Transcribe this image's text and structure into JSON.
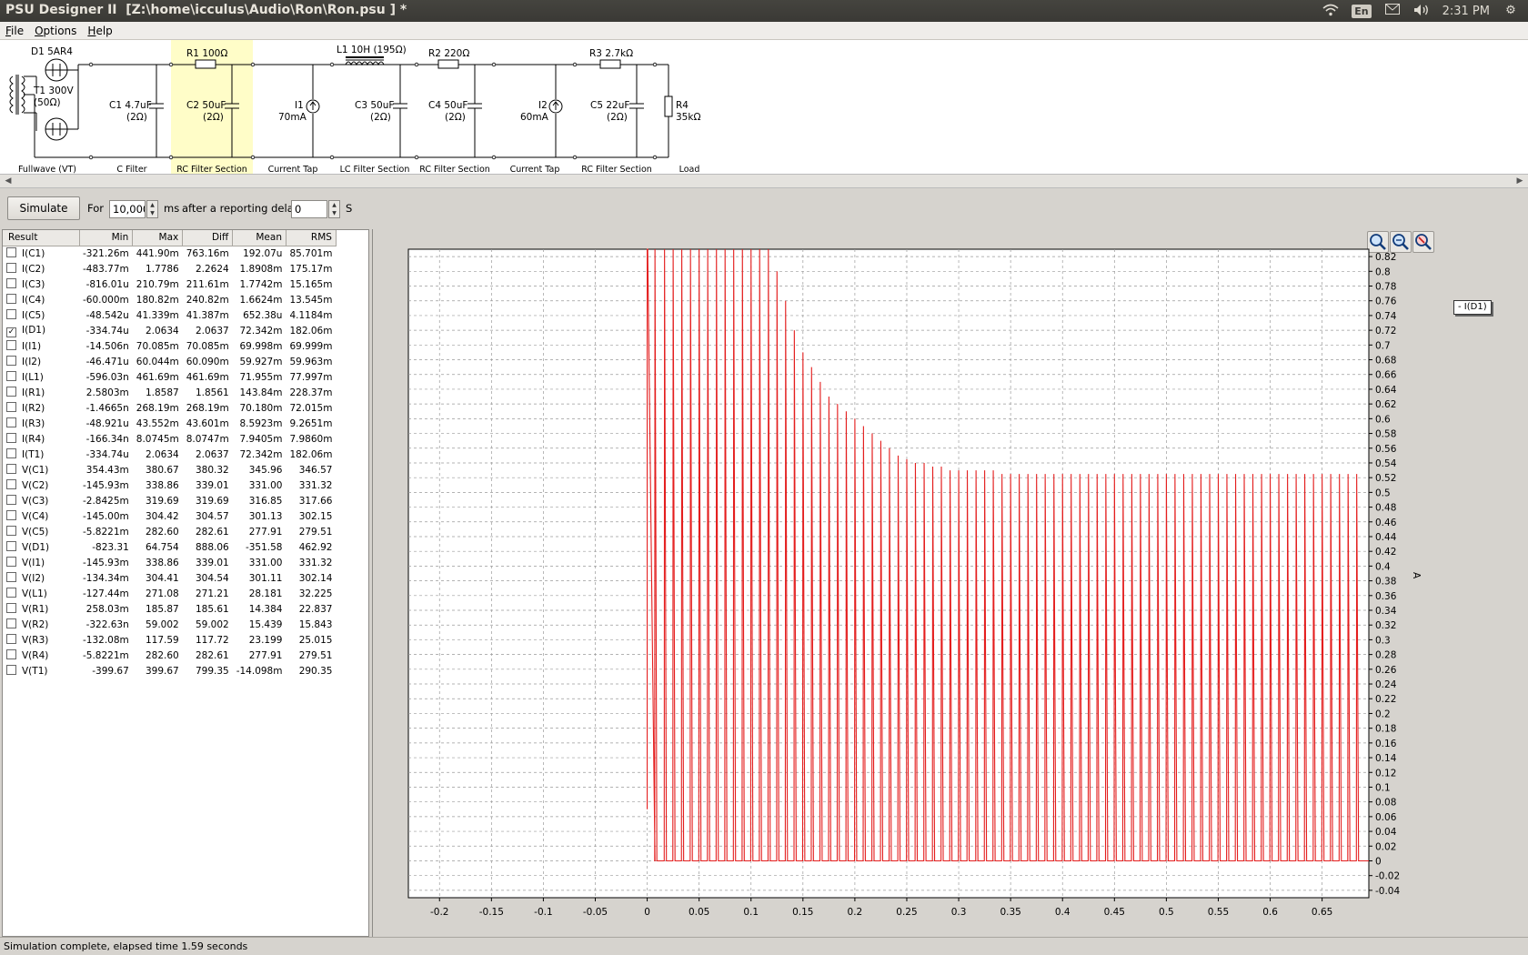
{
  "window": {
    "title": "PSU Designer II  [Z:\\home\\icculus\\Audio\\Ron\\Ron.psu ] *",
    "tray": {
      "keyboard": "En",
      "clock": "2:31 PM",
      "icons": [
        "wifi-icon",
        "keyboard-layout-icon",
        "mail-icon",
        "volume-icon",
        "gear-icon"
      ]
    }
  },
  "menu": {
    "file": "File",
    "options": "Options",
    "help": "Help"
  },
  "schematic": {
    "components": {
      "d1": "D1  5AR4",
      "t1_name": "T1 300V",
      "t1_res": "(50Ω)",
      "c1_name": "C1 4.7uF",
      "c1_res": "(2Ω)",
      "r1": "R1 100Ω",
      "c2_name": "C2 50uF",
      "c2_res": "(2Ω)",
      "i1_name": "I1",
      "i1_val": "70mA",
      "l1": "L1 10H (195Ω)",
      "c3_name": "C3 50uF",
      "c3_res": "(2Ω)",
      "r2": "R2 220Ω",
      "c4_name": "C4 50uF",
      "c4_res": "(2Ω)",
      "i2_name": "I2",
      "i2_val": "60mA",
      "r3": "R3 2.7kΩ",
      "c5_name": "C5 22uF",
      "c5_res": "(2Ω)",
      "r4_name": "R4",
      "r4_val": "35kΩ"
    },
    "sections": [
      "Fullwave (VT)",
      "C Filter",
      "RC Filter Section",
      "Current Tap",
      "LC Filter Section",
      "RC Filter Section",
      "Current Tap",
      "RC Filter Section",
      "Load"
    ],
    "highlight_color": "#fffdc8"
  },
  "toolbar": {
    "simulate_label": "Simulate",
    "for_label": "For",
    "duration_value": "10,000",
    "ms_label": "ms",
    "delay_label": "after a reporting delay of",
    "delay_value": "0",
    "s_label": "S"
  },
  "results": {
    "headers": [
      "Result",
      "Min",
      "Max",
      "Diff",
      "Mean",
      "RMS"
    ],
    "rows": [
      {
        "name": "I(C1)",
        "checked": false,
        "min": "-321.26m",
        "max": "441.90m",
        "diff": "763.16m",
        "mean": "192.07u",
        "rms": "85.701m"
      },
      {
        "name": "I(C2)",
        "checked": false,
        "min": "-483.77m",
        "max": "1.7786",
        "diff": "2.2624",
        "mean": "1.8908m",
        "rms": "175.17m"
      },
      {
        "name": "I(C3)",
        "checked": false,
        "min": "-816.01u",
        "max": "210.79m",
        "diff": "211.61m",
        "mean": "1.7742m",
        "rms": "15.165m"
      },
      {
        "name": "I(C4)",
        "checked": false,
        "min": "-60.000m",
        "max": "180.82m",
        "diff": "240.82m",
        "mean": "1.6624m",
        "rms": "13.545m"
      },
      {
        "name": "I(C5)",
        "checked": false,
        "min": "-48.542u",
        "max": "41.339m",
        "diff": "41.387m",
        "mean": "652.38u",
        "rms": "4.1184m"
      },
      {
        "name": "I(D1)",
        "checked": true,
        "min": "-334.74u",
        "max": "2.0634",
        "diff": "2.0637",
        "mean": "72.342m",
        "rms": "182.06m"
      },
      {
        "name": "I(I1)",
        "checked": false,
        "min": "-14.506n",
        "max": "70.085m",
        "diff": "70.085m",
        "mean": "69.998m",
        "rms": "69.999m"
      },
      {
        "name": "I(I2)",
        "checked": false,
        "min": "-46.471u",
        "max": "60.044m",
        "diff": "60.090m",
        "mean": "59.927m",
        "rms": "59.963m"
      },
      {
        "name": "I(L1)",
        "checked": false,
        "min": "-596.03n",
        "max": "461.69m",
        "diff": "461.69m",
        "mean": "71.955m",
        "rms": "77.997m"
      },
      {
        "name": "I(R1)",
        "checked": false,
        "min": "2.5803m",
        "max": "1.8587",
        "diff": "1.8561",
        "mean": "143.84m",
        "rms": "228.37m"
      },
      {
        "name": "I(R2)",
        "checked": false,
        "min": "-1.4665n",
        "max": "268.19m",
        "diff": "268.19m",
        "mean": "70.180m",
        "rms": "72.015m"
      },
      {
        "name": "I(R3)",
        "checked": false,
        "min": "-48.921u",
        "max": "43.552m",
        "diff": "43.601m",
        "mean": "8.5923m",
        "rms": "9.2651m"
      },
      {
        "name": "I(R4)",
        "checked": false,
        "min": "-166.34n",
        "max": "8.0745m",
        "diff": "8.0747m",
        "mean": "7.9405m",
        "rms": "7.9860m"
      },
      {
        "name": "I(T1)",
        "checked": false,
        "min": "-334.74u",
        "max": "2.0634",
        "diff": "2.0637",
        "mean": "72.342m",
        "rms": "182.06m"
      },
      {
        "name": "V(C1)",
        "checked": false,
        "min": "354.43m",
        "max": "380.67",
        "diff": "380.32",
        "mean": "345.96",
        "rms": "346.57"
      },
      {
        "name": "V(C2)",
        "checked": false,
        "min": "-145.93m",
        "max": "338.86",
        "diff": "339.01",
        "mean": "331.00",
        "rms": "331.32"
      },
      {
        "name": "V(C3)",
        "checked": false,
        "min": "-2.8425m",
        "max": "319.69",
        "diff": "319.69",
        "mean": "316.85",
        "rms": "317.66"
      },
      {
        "name": "V(C4)",
        "checked": false,
        "min": "-145.00m",
        "max": "304.42",
        "diff": "304.57",
        "mean": "301.13",
        "rms": "302.15"
      },
      {
        "name": "V(C5)",
        "checked": false,
        "min": "-5.8221m",
        "max": "282.60",
        "diff": "282.61",
        "mean": "277.91",
        "rms": "279.51"
      },
      {
        "name": "V(D1)",
        "checked": false,
        "min": "-823.31",
        "max": "64.754",
        "diff": "888.06",
        "mean": "-351.58",
        "rms": "462.92"
      },
      {
        "name": "V(I1)",
        "checked": false,
        "min": "-145.93m",
        "max": "338.86",
        "diff": "339.01",
        "mean": "331.00",
        "rms": "331.32"
      },
      {
        "name": "V(I2)",
        "checked": false,
        "min": "-134.34m",
        "max": "304.41",
        "diff": "304.54",
        "mean": "301.11",
        "rms": "302.14"
      },
      {
        "name": "V(L1)",
        "checked": false,
        "min": "-127.44m",
        "max": "271.08",
        "diff": "271.21",
        "mean": "28.181",
        "rms": "32.225"
      },
      {
        "name": "V(R1)",
        "checked": false,
        "min": "258.03m",
        "max": "185.87",
        "diff": "185.61",
        "mean": "14.384",
        "rms": "22.837"
      },
      {
        "name": "V(R2)",
        "checked": false,
        "min": "-322.63n",
        "max": "59.002",
        "diff": "59.002",
        "mean": "15.439",
        "rms": "15.843"
      },
      {
        "name": "V(R3)",
        "checked": false,
        "min": "-132.08m",
        "max": "117.59",
        "diff": "117.72",
        "mean": "23.199",
        "rms": "25.015"
      },
      {
        "name": "V(R4)",
        "checked": false,
        "min": "-5.8221m",
        "max": "282.60",
        "diff": "282.61",
        "mean": "277.91",
        "rms": "279.51"
      },
      {
        "name": "V(T1)",
        "checked": false,
        "min": "-399.67",
        "max": "399.67",
        "diff": "799.35",
        "mean": "-14.098m",
        "rms": "290.35"
      }
    ]
  },
  "chart_data": {
    "type": "line",
    "series": [
      {
        "name": "I(D1)",
        "color": "#e41e1e",
        "peak_t": [
          0.0,
          0.0075,
          0.0167,
          0.025,
          0.0333,
          0.0417,
          0.05,
          0.0583,
          0.0667,
          0.075,
          0.0833,
          0.0917,
          0.1,
          0.1083,
          0.1167,
          0.125,
          0.1333,
          0.1417,
          0.15,
          0.1583,
          0.1667,
          0.175,
          0.1833,
          0.1917,
          0.2,
          0.2083,
          0.2167,
          0.225,
          0.2333,
          0.2417,
          0.25,
          0.2583,
          0.2667,
          0.275,
          0.2833,
          0.2917,
          0.3,
          0.3083,
          0.3167,
          0.325,
          0.3333,
          0.3417,
          0.35,
          0.3583,
          0.3667,
          0.375,
          0.3833,
          0.3917,
          0.4,
          0.4083,
          0.4167,
          0.425,
          0.4333,
          0.4417,
          0.45,
          0.4583,
          0.4667,
          0.475,
          0.4833,
          0.4917,
          0.5,
          0.5083,
          0.5167,
          0.525,
          0.5333,
          0.5417,
          0.55,
          0.5583,
          0.5667,
          0.575,
          0.5833,
          0.5917,
          0.6,
          0.6083,
          0.6167,
          0.625,
          0.6333,
          0.6417,
          0.65,
          0.6583,
          0.6667,
          0.675,
          0.6833
        ],
        "peak_a": [
          0.83,
          0.83,
          0.83,
          0.83,
          0.83,
          0.83,
          0.83,
          0.83,
          0.83,
          0.83,
          0.83,
          0.83,
          0.83,
          0.83,
          0.83,
          0.8,
          0.76,
          0.72,
          0.69,
          0.67,
          0.65,
          0.63,
          0.62,
          0.61,
          0.6,
          0.59,
          0.58,
          0.57,
          0.56,
          0.55,
          0.545,
          0.54,
          0.54,
          0.535,
          0.535,
          0.53,
          0.53,
          0.53,
          0.53,
          0.53,
          0.53,
          0.525,
          0.525,
          0.525,
          0.525,
          0.525,
          0.525,
          0.525,
          0.525,
          0.525,
          0.525,
          0.525,
          0.525,
          0.525,
          0.525,
          0.525,
          0.525,
          0.525,
          0.525,
          0.525,
          0.525,
          0.525,
          0.525,
          0.525,
          0.525,
          0.525,
          0.525,
          0.525,
          0.525,
          0.525,
          0.525,
          0.525,
          0.525,
          0.525,
          0.525,
          0.525,
          0.525,
          0.525,
          0.525,
          0.525,
          0.525,
          0.525,
          0.525
        ]
      }
    ],
    "initial_value": 0.07,
    "xlim": [
      -0.23,
      0.695
    ],
    "ylim": [
      -0.05,
      0.83
    ],
    "x_ticks": [
      -0.2,
      -0.15,
      -0.1,
      -0.05,
      0,
      0.05,
      0.1,
      0.15,
      0.2,
      0.25,
      0.3,
      0.35,
      0.4,
      0.45,
      0.5,
      0.55,
      0.6,
      0.65
    ],
    "x_tick_labels": [
      "-0.2",
      "-0.15",
      "-0.1",
      "-0.05",
      "0",
      "0.05",
      "0.1",
      "0.15",
      "0.2",
      "0.25",
      "0.3",
      "0.35",
      "0.4",
      "0.45",
      "0.5",
      "0.55",
      "0.6",
      "0.65"
    ],
    "y_ticks": [
      -0.04,
      -0.02,
      0,
      0.02,
      0.04,
      0.06,
      0.08,
      0.1,
      0.12,
      0.14,
      0.16,
      0.18,
      0.2,
      0.22,
      0.24,
      0.26,
      0.28,
      0.3,
      0.32,
      0.34,
      0.36,
      0.38,
      0.4,
      0.42,
      0.44,
      0.46,
      0.48,
      0.5,
      0.52,
      0.54,
      0.56,
      0.58,
      0.6,
      0.62,
      0.64,
      0.66,
      0.68,
      0.7,
      0.72,
      0.74,
      0.76,
      0.78,
      0.8,
      0.82
    ],
    "y_tick_labels": [
      "-0.04",
      "-0.02",
      "0",
      "0.02",
      "0.04",
      "0.06",
      "0.08",
      "0.1",
      "0.12",
      "0.14",
      "0.16",
      "0.18",
      "0.2",
      "0.22",
      "0.24",
      "0.26",
      "0.28",
      "0.3",
      "0.32",
      "0.34",
      "0.36",
      "0.38",
      "0.4",
      "0.42",
      "0.44",
      "0.46",
      "0.48",
      "0.5",
      "0.52",
      "0.54",
      "0.56",
      "0.58",
      "0.6",
      "0.62",
      "0.64",
      "0.66",
      "0.68",
      "0.7",
      "0.72",
      "0.74",
      "0.76",
      "0.78",
      "0.8",
      "0.82"
    ],
    "ylabel": "A",
    "legend_label": "- I(D1)",
    "legend_position": "right",
    "grid": true,
    "grid_style": "dashed",
    "plot_background": "#ffffff"
  },
  "status": {
    "text": "Simulation complete, elapsed time 1.59 seconds"
  }
}
